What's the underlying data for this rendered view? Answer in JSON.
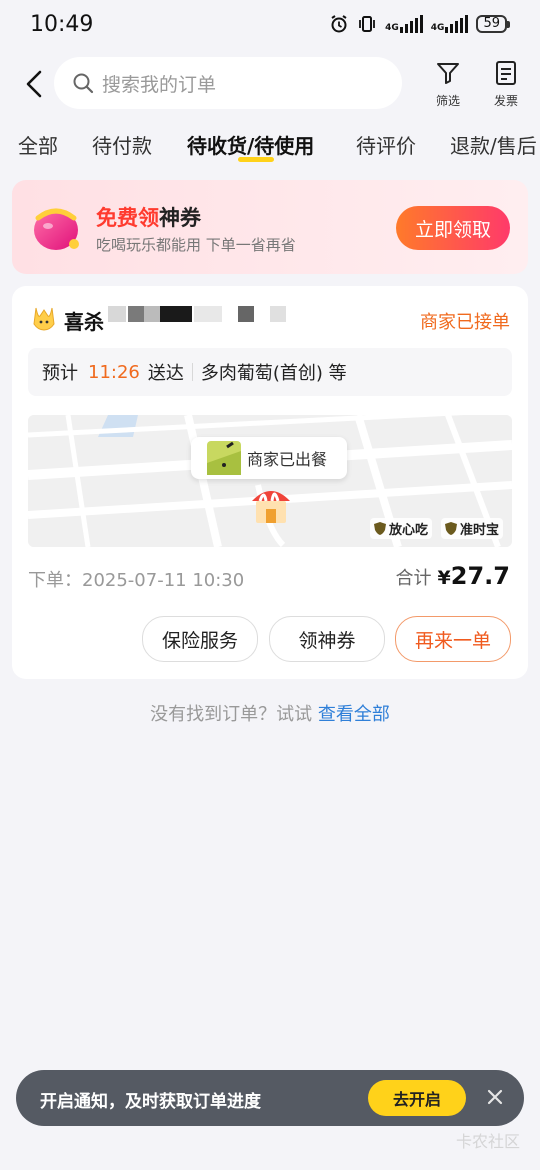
{
  "status_bar": {
    "time": "10:49",
    "network": "4G",
    "battery": "59"
  },
  "header": {
    "search_placeholder": "搜索我的订单",
    "filter_label": "筛选",
    "invoice_label": "发票"
  },
  "tabs": [
    {
      "label": "全部"
    },
    {
      "label": "待付款"
    },
    {
      "label": "待收货/待使用"
    },
    {
      "label": "待评价"
    },
    {
      "label": "退款/售后"
    }
  ],
  "coupon": {
    "title_highlight": "免费领",
    "title_rest": "神券",
    "subtitle": "吃喝玩乐都能用 下单一省再省",
    "button": "立即领取"
  },
  "order": {
    "shop_name_start": "喜杀",
    "status": "商家已接单",
    "eta_prefix": "预计",
    "eta_time": "11:26",
    "eta_suffix": "送达",
    "items": "多肉葡萄(首创) 等",
    "map_status": "商家已出餐",
    "guarantee_1": "放心吃",
    "guarantee_2": "准时宝",
    "order_time": "下单：2025-07-11 10:30",
    "total_label": "合计",
    "currency": "¥",
    "total": "27.7",
    "actions": [
      "保险服务",
      "领神券",
      "再来一单"
    ]
  },
  "footer": {
    "not_found": "没有找到订单？试试",
    "view_all": "查看全部"
  },
  "notification": {
    "text": "开启通知，及时获取订单进度",
    "button": "去开启"
  },
  "watermark": "卡农社区",
  "colors": {
    "accent_orange": "#f06a1e",
    "tab_underline": "#ffd21a",
    "link_blue": "#2f7fd8"
  }
}
